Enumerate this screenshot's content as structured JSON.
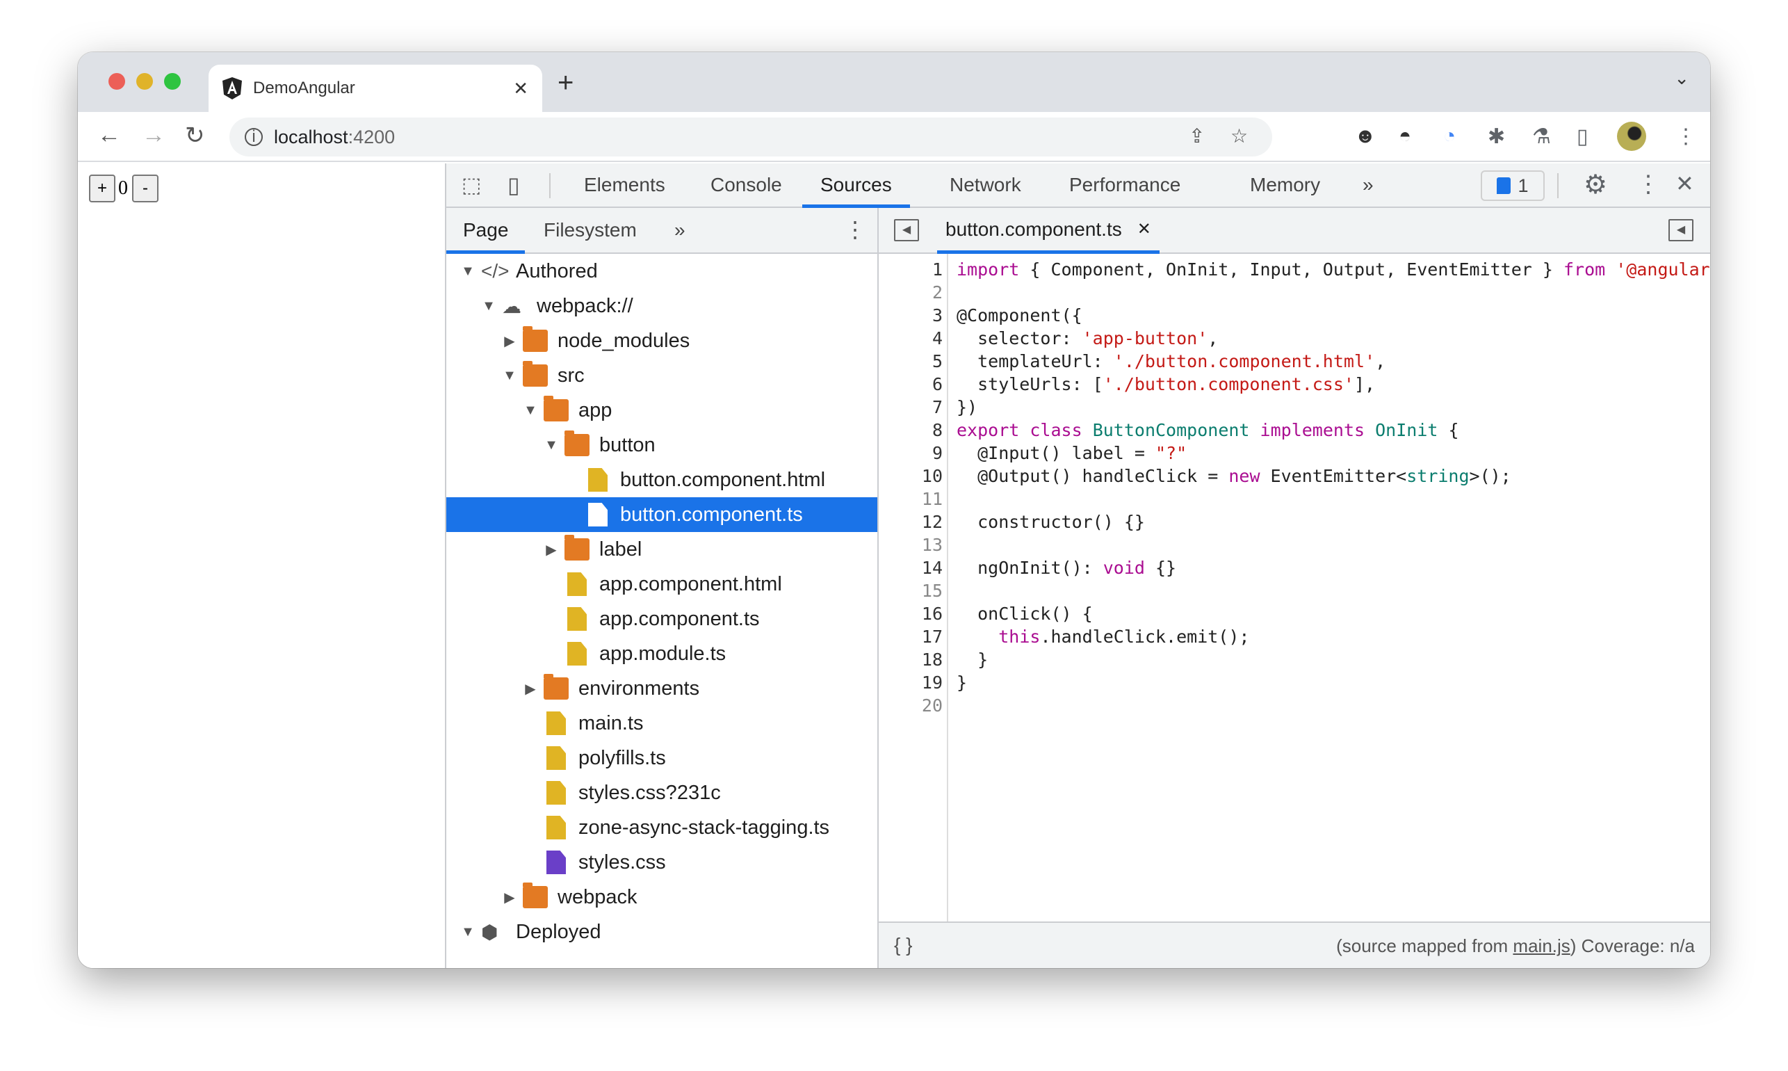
{
  "browser": {
    "tab_title": "DemoAngular",
    "tab_icon": "angular-icon",
    "address_host": "localhost",
    "address_port": ":4200",
    "new_tab": "+",
    "tab_close": "✕"
  },
  "page": {
    "plus": "+",
    "count": "0",
    "minus": "-"
  },
  "devtools": {
    "tabs": [
      "Elements",
      "Console",
      "Sources",
      "Network",
      "Performance",
      "Memory"
    ],
    "active_tab": "Sources",
    "more": "»",
    "issues_count": "1",
    "nav_tabs": [
      "Page",
      "Filesystem"
    ],
    "tree": [
      {
        "label": "Authored",
        "level": 0,
        "arrow": "open",
        "icon": "code"
      },
      {
        "label": "webpack://",
        "level": 1,
        "arrow": "open",
        "icon": "cloud"
      },
      {
        "label": "node_modules",
        "level": 2,
        "arrow": "closed",
        "icon": "folder"
      },
      {
        "label": "src",
        "level": 2,
        "arrow": "open",
        "icon": "folder"
      },
      {
        "label": "app",
        "level": 3,
        "arrow": "open",
        "icon": "folder"
      },
      {
        "label": "button",
        "level": 4,
        "arrow": "open",
        "icon": "folder"
      },
      {
        "label": "button.component.html",
        "level": 5,
        "icon": "file"
      },
      {
        "label": "button.component.ts",
        "level": 5,
        "icon": "file",
        "selected": true
      },
      {
        "label": "label",
        "level": 4,
        "arrow": "closed",
        "icon": "folder"
      },
      {
        "label": "app.component.html",
        "level": 4,
        "icon": "file"
      },
      {
        "label": "app.component.ts",
        "level": 4,
        "icon": "file"
      },
      {
        "label": "app.module.ts",
        "level": 4,
        "icon": "file"
      },
      {
        "label": "environments",
        "level": 3,
        "arrow": "closed",
        "icon": "folder"
      },
      {
        "label": "main.ts",
        "level": 3,
        "icon": "file"
      },
      {
        "label": "polyfills.ts",
        "level": 3,
        "icon": "file"
      },
      {
        "label": "styles.css?231c",
        "level": 3,
        "icon": "file"
      },
      {
        "label": "zone-async-stack-tagging.ts",
        "level": 3,
        "icon": "file"
      },
      {
        "label": "styles.css",
        "level": 3,
        "icon": "file-purple"
      },
      {
        "label": "webpack",
        "level": 2,
        "arrow": "closed",
        "icon": "folder"
      },
      {
        "label": "Deployed",
        "level": 0,
        "arrow": "open",
        "icon": "box"
      }
    ],
    "editor_tab": "button.component.ts",
    "code": [
      [
        [
          "import",
          "kw"
        ],
        [
          " { Component, OnInit, Input, Output, EventEmitter } ",
          ""
        ],
        [
          "from",
          "kw"
        ],
        [
          " '@angular/core';",
          "str"
        ]
      ],
      [],
      [
        [
          "@Component({",
          ""
        ]
      ],
      [
        [
          "  selector: ",
          ""
        ],
        [
          "'app-button'",
          "str"
        ],
        [
          ",",
          ""
        ]
      ],
      [
        [
          "  templateUrl: ",
          ""
        ],
        [
          "'./button.component.html'",
          "str"
        ],
        [
          ",",
          ""
        ]
      ],
      [
        [
          "  styleUrls: [",
          ""
        ],
        [
          "'./button.component.css'",
          "str"
        ],
        [
          "],",
          ""
        ]
      ],
      [
        [
          "})",
          ""
        ]
      ],
      [
        [
          "export",
          "kw"
        ],
        [
          " ",
          ""
        ],
        [
          "class",
          "kw"
        ],
        [
          " ",
          ""
        ],
        [
          "ButtonComponent",
          "ty"
        ],
        [
          " ",
          ""
        ],
        [
          "implements",
          "kw"
        ],
        [
          " ",
          ""
        ],
        [
          "OnInit",
          "ty"
        ],
        [
          " {",
          ""
        ]
      ],
      [
        [
          "  @Input() label = ",
          ""
        ],
        [
          "\"?\"",
          "str"
        ]
      ],
      [
        [
          "  @Output() handleClick = ",
          ""
        ],
        [
          "new",
          "kw"
        ],
        [
          " EventEmitter<",
          ""
        ],
        [
          "string",
          "ty"
        ],
        [
          ">();",
          ""
        ]
      ],
      [],
      [
        [
          "  constructor() {}",
          ""
        ]
      ],
      [],
      [
        [
          "  ngOnInit(): ",
          ""
        ],
        [
          "void",
          "kw"
        ],
        [
          " {}",
          ""
        ]
      ],
      [],
      [
        [
          "  onClick() {",
          ""
        ]
      ],
      [
        [
          "    ",
          ""
        ],
        [
          "this",
          "kw"
        ],
        [
          ".handleClick.emit();",
          ""
        ]
      ],
      [
        [
          "  }",
          ""
        ]
      ],
      [
        [
          "}",
          ""
        ]
      ],
      []
    ],
    "status": {
      "format": "{ }",
      "prefix": "(source mapped from ",
      "link": "main.js",
      "suffix": ") Coverage: n/a"
    }
  }
}
